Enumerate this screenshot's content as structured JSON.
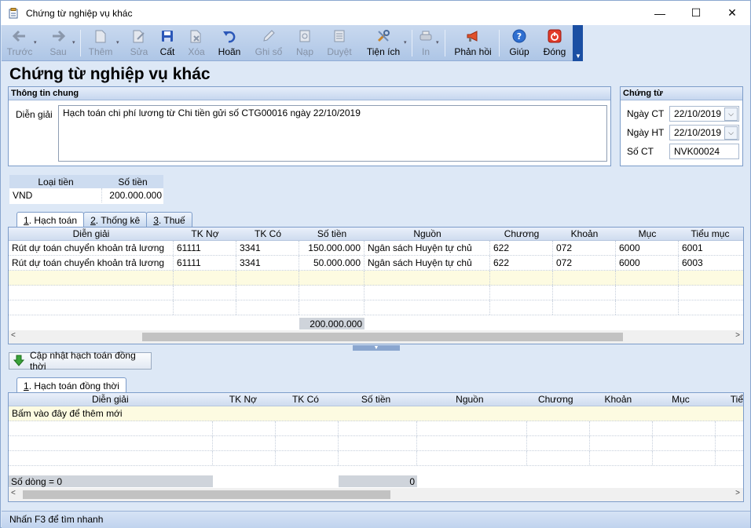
{
  "window": {
    "title": "Chứng từ nghiệp vụ khác",
    "minimize": "—",
    "maximize": "☐",
    "close": "✕"
  },
  "toolbar": {
    "back": "Trước",
    "forward": "Sau",
    "add": "Thêm",
    "edit": "Sửa",
    "save": "Cất",
    "delete": "Xóa",
    "undo": "Hoãn",
    "post": "Ghi sổ",
    "load": "Nạp",
    "approve": "Duyệt",
    "utilities": "Tiện ích",
    "print": "In",
    "feedback": "Phản hồi",
    "help": "Giúp",
    "close": "Đóng"
  },
  "page_title": "Chứng từ nghiệp vụ khác",
  "general": {
    "header": "Thông tin chung",
    "desc_label": "Diễn giải",
    "desc_value": "Hạch toán chi phí lương từ Chi tiền gửi số CTG00016 ngày 22/10/2019"
  },
  "voucher": {
    "header": "Chứng từ",
    "date_ct_label": "Ngày CT",
    "date_ct": "22/10/2019",
    "date_ht_label": "Ngày HT",
    "date_ht": "22/10/2019",
    "no_label": "Số CT",
    "no": "NVK00024"
  },
  "currency": {
    "col_type": "Loại tiền",
    "col_amount": "Số tiền",
    "type": "VND",
    "amount": "200.000.000"
  },
  "tabs1": [
    {
      "num": "1",
      "label": ". Hạch toán"
    },
    {
      "num": "2",
      "label": ". Thống kê"
    },
    {
      "num": "3",
      "label": ". Thuế"
    }
  ],
  "grid1": {
    "columns": [
      "Diễn giải",
      "TK Nợ",
      "TK Có",
      "Số tiền",
      "Nguồn",
      "Chương",
      "Khoản",
      "Mục",
      "Tiểu mục"
    ],
    "rows": [
      [
        "Rút dự toán chuyển khoản trả lương",
        "61111",
        "3341",
        "150.000.000",
        "Ngân sách Huyện tự chủ",
        "622",
        "072",
        "6000",
        "6001"
      ],
      [
        "Rút dự toán chuyển khoản trả lương",
        "61111",
        "3341",
        "50.000.000",
        "Ngân sách Huyện tự chủ",
        "622",
        "072",
        "6000",
        "6003"
      ]
    ],
    "total": "200.000.000"
  },
  "update_button": "Cập nhật hạch toán đồng thời",
  "tabs2": [
    {
      "num": "1",
      "label": ". Hạch toán đồng thời"
    }
  ],
  "grid2": {
    "columns": [
      "Diễn giải",
      "TK Nợ",
      "TK Có",
      "Số tiền",
      "Nguồn",
      "Chương",
      "Khoản",
      "Mục",
      "Tiể"
    ],
    "new_row_hint": "Bấm vào đây để thêm mới",
    "row_count": "Số dòng = 0",
    "total": "0"
  },
  "status": "Nhấn F3 để tìm nhanh"
}
